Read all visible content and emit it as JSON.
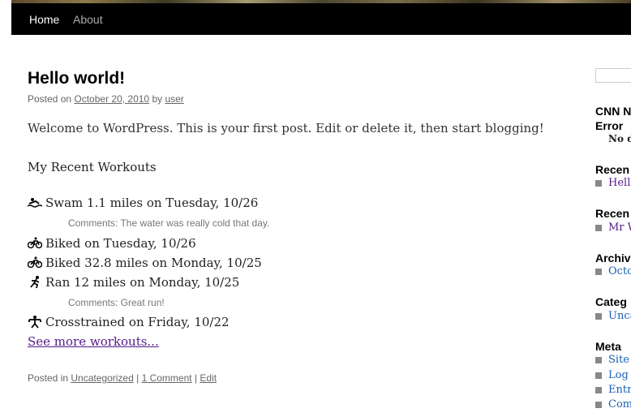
{
  "nav": {
    "home": "Home",
    "about": "About"
  },
  "post": {
    "title": "Hello world!",
    "meta_posted_on": "Posted on ",
    "date": "October 20, 2010",
    "meta_by": " by ",
    "author": "user",
    "body": "Welcome to WordPress. This is your first post. Edit or delete it, then start blogging!",
    "workouts_heading": "My Recent Workouts",
    "workouts": [
      {
        "icon": "swim-icon",
        "text": "Swam 1.1 miles on Tuesday, 10/26",
        "comment": "Comments: The water was really cold that day."
      },
      {
        "icon": "bike-icon",
        "text": "Biked on Tuesday, 10/26"
      },
      {
        "icon": "bike-icon",
        "text": "Biked 32.8 miles on Monday, 10/25"
      },
      {
        "icon": "run-icon",
        "text": "Ran 12 miles on Monday, 10/25",
        "comment": "Comments: Great run!"
      },
      {
        "icon": "crosstrain-icon",
        "text": "Crosstrained on Friday, 10/22"
      }
    ],
    "see_more": "See more workouts...",
    "footer_posted_in": "Posted in ",
    "category": "Uncategorized",
    "sep1": " | ",
    "comments_link": "1 Comment",
    "sep2": " | ",
    "edit": "Edit"
  },
  "sidebar": {
    "cnn_title_line1": "CNN N",
    "cnn_title_line2": "Error",
    "cnn_text": "No d",
    "recent_posts_title": "Recen",
    "recent_posts_item": "Hello",
    "recent_comments_title": "Recen",
    "recent_comments_item": "Mr W",
    "archives_title": "Archiv",
    "archives_item": "Octob",
    "categories_title": "Categ",
    "categories_item": "Unca",
    "meta_title": "Meta",
    "meta_items": [
      "Site A",
      "Log o",
      "Entr",
      "Comm"
    ]
  },
  "colors": {
    "nav_bg": "#000000",
    "link": "#1a5fb4",
    "visited": "#551a8b"
  }
}
